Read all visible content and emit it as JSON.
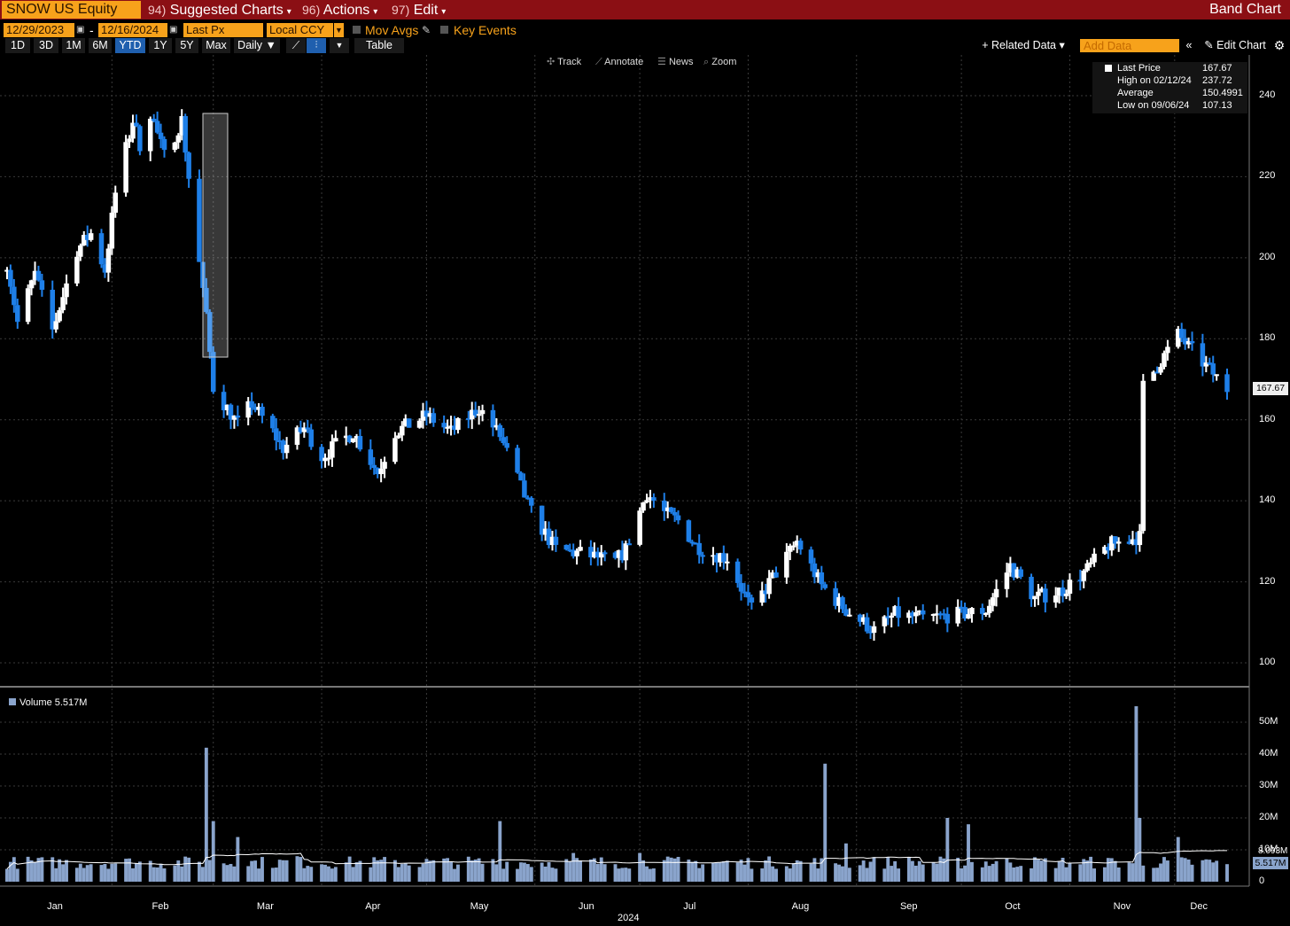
{
  "header": {
    "ticker": "SNOW US Equity",
    "menu_suggested_code": "94)",
    "menu_suggested": "Suggested Charts",
    "menu_actions_code": "96)",
    "menu_actions": "Actions",
    "menu_edit_code": "97)",
    "menu_edit": "Edit",
    "title": "Band Chart"
  },
  "controls": {
    "start_date": "12/29/2023",
    "end_date": "12/16/2024",
    "date_separator": "-",
    "price_field": "Last Px",
    "currency": "Local CCY",
    "mov_avgs": "Mov Avgs",
    "key_events": "Key Events"
  },
  "ranges": {
    "buttons": [
      "1D",
      "3D",
      "1M",
      "6M",
      "YTD",
      "1Y",
      "5Y",
      "Max"
    ],
    "active": "YTD",
    "frequency": "Daily",
    "table": "Table",
    "related_data": "Related Data",
    "add_data_placeholder": "Add Data",
    "edit_chart": "Edit Chart"
  },
  "tools": {
    "track": "Track",
    "annotate": "Annotate",
    "news": "News",
    "zoom": "Zoom"
  },
  "legend": {
    "last_label": "Last Price",
    "last_value": "167.67",
    "high_label": "High on 02/12/24",
    "high_value": "237.72",
    "avg_label": "Average",
    "avg_value": "150.4991",
    "low_label": "Low on 09/06/24",
    "low_value": "107.13"
  },
  "colors": {
    "up": "#ffffff",
    "down": "#1e7fe8",
    "accent": "#f7a21b",
    "titlebar": "#8b0f14",
    "volume": "#8aa4cc"
  },
  "chart_data": {
    "type": "band",
    "title": "",
    "x_label": "2024",
    "months": [
      "Jan",
      "Feb",
      "Mar",
      "Apr",
      "May",
      "Jun",
      "Jul",
      "Aug",
      "Sep",
      "Oct",
      "Nov",
      "Dec"
    ],
    "price_axis": {
      "ticks": [
        "240",
        "220",
        "200",
        "180",
        "160",
        "140",
        "120",
        "100"
      ],
      "min": 100,
      "max": 240
    },
    "volume_axis": {
      "ticks": [
        "50M",
        "40M",
        "30M",
        "20M",
        "10M",
        "0"
      ]
    },
    "last_price_label": "167.67",
    "volume_legend": "Volume 5.517M",
    "volume_last_label": "5.517M",
    "volume_ma_label": "8.093M",
    "price_keypoints": [
      [
        "2024-01-02",
        199
      ],
      [
        "2024-01-05",
        184
      ],
      [
        "2024-01-10",
        196
      ],
      [
        "2024-01-15",
        182
      ],
      [
        "2024-01-22",
        202
      ],
      [
        "2024-01-26",
        206
      ],
      [
        "2024-01-30",
        197
      ],
      [
        "2024-02-02",
        216
      ],
      [
        "2024-02-07",
        234
      ],
      [
        "2024-02-09",
        228
      ],
      [
        "2024-02-12",
        236
      ],
      [
        "2024-02-16",
        225
      ],
      [
        "2024-02-21",
        234
      ],
      [
        "2024-02-28",
        185
      ],
      [
        "2024-03-01",
        168
      ],
      [
        "2024-03-08",
        159
      ],
      [
        "2024-03-12",
        164
      ],
      [
        "2024-03-18",
        157
      ],
      [
        "2024-03-21",
        153
      ],
      [
        "2024-03-27",
        158
      ],
      [
        "2024-04-01",
        151
      ],
      [
        "2024-04-10",
        157
      ],
      [
        "2024-04-17",
        147
      ],
      [
        "2024-04-22",
        157
      ],
      [
        "2024-05-01",
        161
      ],
      [
        "2024-05-08",
        157
      ],
      [
        "2024-05-16",
        163
      ],
      [
        "2024-05-22",
        156
      ],
      [
        "2024-05-31",
        137
      ],
      [
        "2024-06-07",
        128
      ],
      [
        "2024-06-14",
        127
      ],
      [
        "2024-06-24",
        125
      ],
      [
        "2024-06-27",
        128
      ],
      [
        "2024-07-03",
        142
      ],
      [
        "2024-07-08",
        137
      ],
      [
        "2024-07-12",
        135
      ],
      [
        "2024-07-17",
        129
      ],
      [
        "2024-07-22",
        127
      ],
      [
        "2024-07-26",
        126
      ],
      [
        "2024-08-02",
        113
      ],
      [
        "2024-08-08",
        121
      ],
      [
        "2024-08-15",
        130
      ],
      [
        "2024-08-22",
        119
      ],
      [
        "2024-08-29",
        113
      ],
      [
        "2024-09-06",
        108
      ],
      [
        "2024-09-12",
        112
      ],
      [
        "2024-09-20",
        111
      ],
      [
        "2024-10-01",
        112
      ],
      [
        "2024-10-08",
        113
      ],
      [
        "2024-10-15",
        124
      ],
      [
        "2024-10-22",
        116
      ],
      [
        "2024-10-30",
        118
      ],
      [
        "2024-11-06",
        123
      ],
      [
        "2024-11-12",
        129
      ],
      [
        "2024-11-20",
        131
      ],
      [
        "2024-11-21",
        167
      ],
      [
        "2024-11-25",
        172
      ],
      [
        "2024-12-02",
        181
      ],
      [
        "2024-12-06",
        177
      ],
      [
        "2024-12-16",
        167.67
      ]
    ],
    "volume_keypoints_millions": [
      [
        "2024-01-02",
        4
      ],
      [
        "2024-02-28",
        42
      ],
      [
        "2024-03-01",
        19
      ],
      [
        "2024-03-08",
        14
      ],
      [
        "2024-03-25",
        8
      ],
      [
        "2024-05-22",
        19
      ],
      [
        "2024-06-12",
        9
      ],
      [
        "2024-07-01",
        9
      ],
      [
        "2024-08-23",
        37
      ],
      [
        "2024-08-29",
        12
      ],
      [
        "2024-09-27",
        20
      ],
      [
        "2024-10-03",
        18
      ],
      [
        "2024-10-15",
        6
      ],
      [
        "2024-11-20",
        55
      ],
      [
        "2024-11-21",
        20
      ],
      [
        "2024-12-02",
        14
      ],
      [
        "2024-12-16",
        5.5
      ]
    ]
  }
}
